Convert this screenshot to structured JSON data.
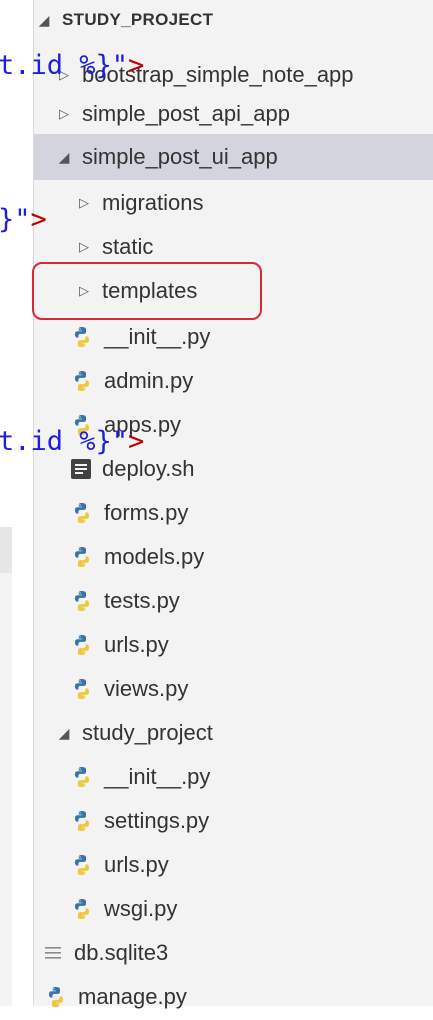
{
  "colors": {
    "panel_bg": "#f3f3f3",
    "selected_bg": "#d4d4de",
    "highlight": "#d6283a",
    "python_blue": "#3774a8",
    "python_yellow": "#f0c63a"
  },
  "code_fragments": [
    {
      "text": "t.id %}\"",
      "gt": ">"
    },
    {
      "text": "}\"",
      "gt": ">"
    },
    {
      "text": "t.id %}\"",
      "gt": ">"
    }
  ],
  "explorer": {
    "header": "STUDY_PROJECT",
    "items": [
      {
        "label": "bootstrap_simple_note_app",
        "type": "folder",
        "expanded": false,
        "icon": "chevron-right-icon"
      },
      {
        "label": "simple_post_api_app",
        "type": "folder",
        "expanded": false,
        "icon": "chevron-right-icon"
      },
      {
        "label": "simple_post_ui_app",
        "type": "folder",
        "expanded": true,
        "selected": true,
        "icon": "chevron-down-icon"
      },
      {
        "label": "migrations",
        "type": "folder",
        "expanded": false,
        "icon": "chevron-right-icon"
      },
      {
        "label": "static",
        "type": "folder",
        "expanded": false,
        "icon": "chevron-right-icon"
      },
      {
        "label": "templates",
        "type": "folder",
        "expanded": false,
        "highlighted": true,
        "icon": "chevron-right-icon"
      },
      {
        "label": "__init__.py",
        "type": "file",
        "icon": "python-icon"
      },
      {
        "label": "admin.py",
        "type": "file",
        "icon": "python-icon"
      },
      {
        "label": "apps.py",
        "type": "file",
        "icon": "python-icon"
      },
      {
        "label": "deploy.sh",
        "type": "file",
        "icon": "document-icon"
      },
      {
        "label": "forms.py",
        "type": "file",
        "icon": "python-icon"
      },
      {
        "label": "models.py",
        "type": "file",
        "icon": "python-icon"
      },
      {
        "label": "tests.py",
        "type": "file",
        "icon": "python-icon"
      },
      {
        "label": "urls.py",
        "type": "file",
        "icon": "python-icon"
      },
      {
        "label": "views.py",
        "type": "file",
        "icon": "python-icon"
      },
      {
        "label": "study_project",
        "type": "folder",
        "expanded": true,
        "icon": "chevron-down-icon"
      },
      {
        "label": "__init__.py",
        "type": "file",
        "icon": "python-icon"
      },
      {
        "label": "settings.py",
        "type": "file",
        "icon": "python-icon"
      },
      {
        "label": "urls.py",
        "type": "file",
        "icon": "python-icon"
      },
      {
        "label": "wsgi.py",
        "type": "file",
        "icon": "python-icon"
      },
      {
        "label": "db.sqlite3",
        "type": "file",
        "icon": "lines-icon"
      },
      {
        "label": "manage.py",
        "type": "file",
        "icon": "python-icon"
      }
    ]
  }
}
